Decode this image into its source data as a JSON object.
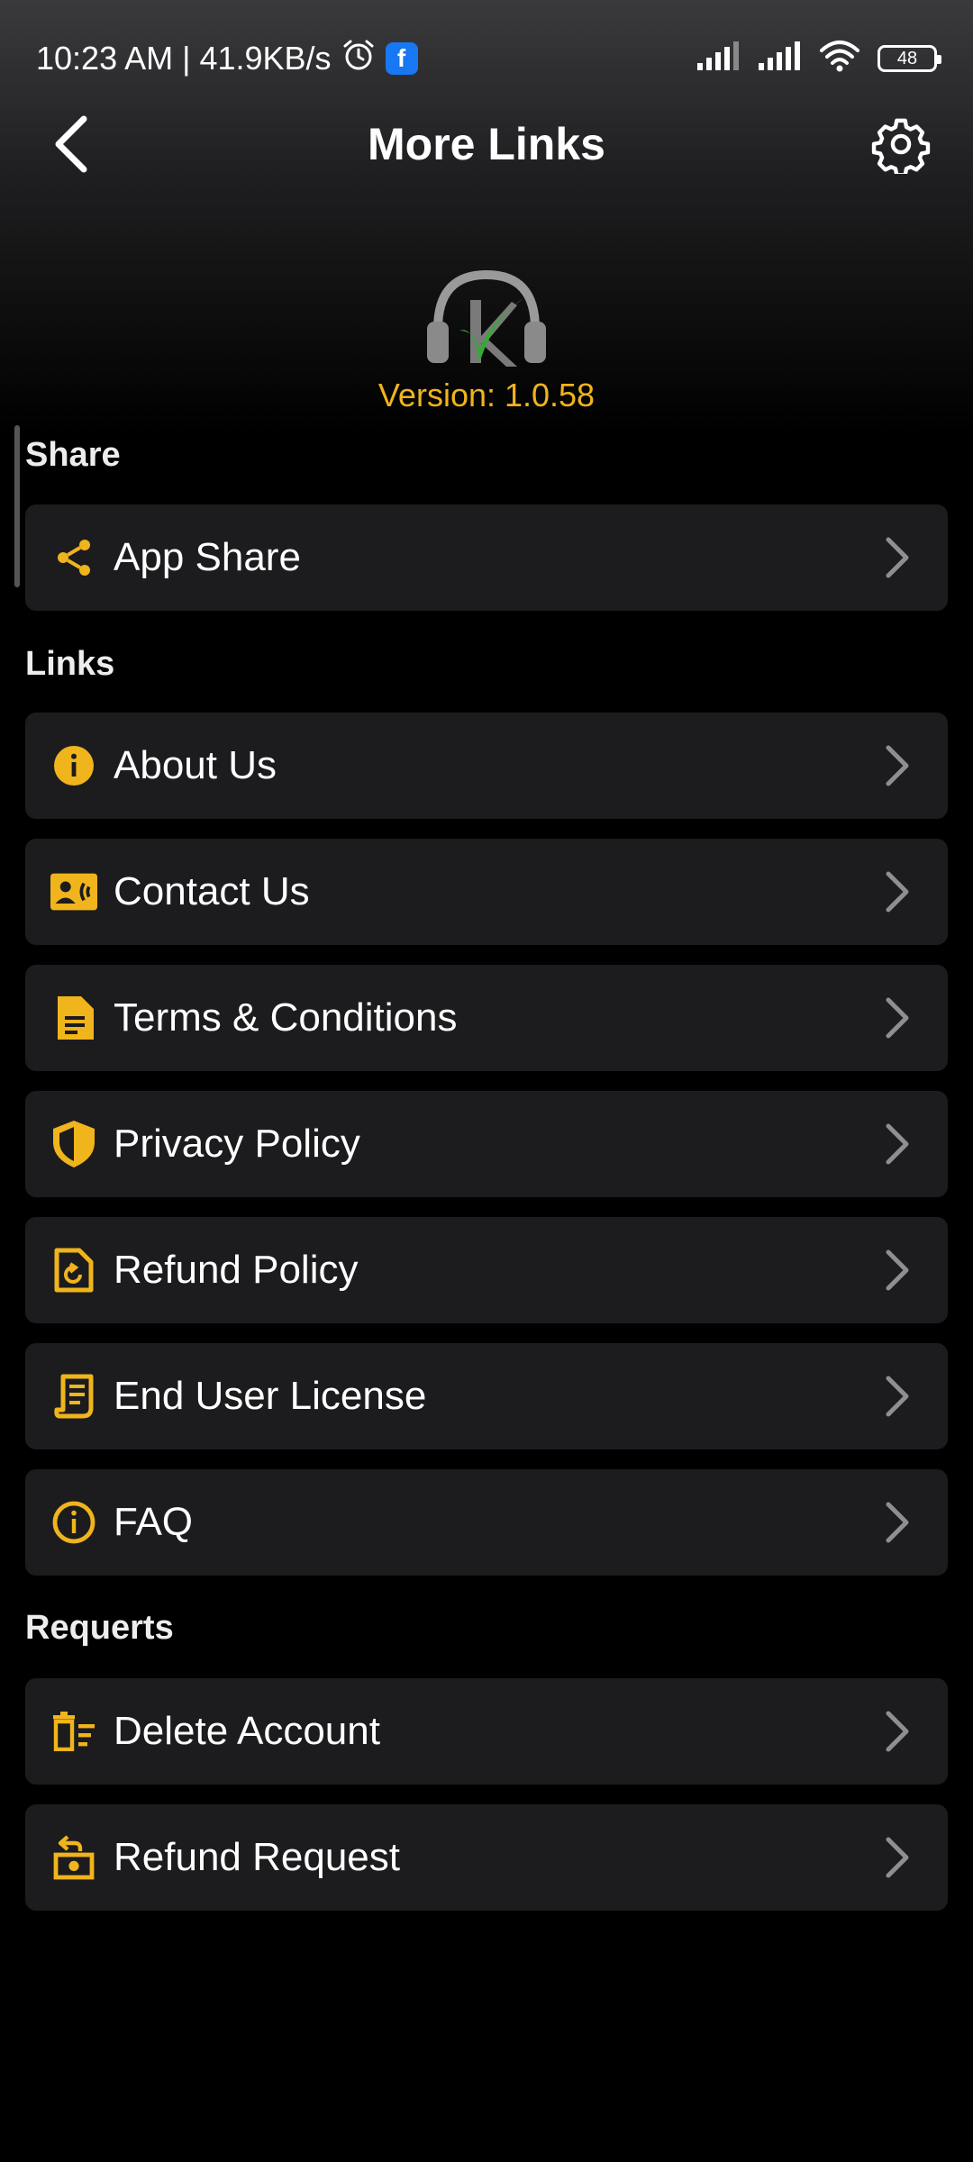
{
  "status_bar": {
    "time": "10:23 AM",
    "separator": "|",
    "speed": "41.9KB/s",
    "fb_letter": "f",
    "battery": "48"
  },
  "header": {
    "title": "More Links"
  },
  "app": {
    "version": "Version: 1.0.58"
  },
  "sections": {
    "share": {
      "label": "Share",
      "items": [
        {
          "label": "App Share",
          "icon": "share-icon"
        }
      ]
    },
    "links": {
      "label": "Links",
      "items": [
        {
          "label": "About Us",
          "icon": "info-filled-icon"
        },
        {
          "label": "Contact Us",
          "icon": "contact-card-icon"
        },
        {
          "label": "Terms & Conditions",
          "icon": "document-icon"
        },
        {
          "label": "Privacy Policy",
          "icon": "shield-icon"
        },
        {
          "label": "Refund Policy",
          "icon": "refund-document-icon"
        },
        {
          "label": "End User License",
          "icon": "license-icon"
        },
        {
          "label": "FAQ",
          "icon": "info-outline-icon"
        }
      ]
    },
    "requests": {
      "label": "Requerts",
      "items": [
        {
          "label": "Delete Account",
          "icon": "delete-account-icon"
        },
        {
          "label": "Refund Request",
          "icon": "refund-request-icon"
        }
      ]
    }
  },
  "colors": {
    "accent": "#f0b41c",
    "row_background": "#1c1c1e",
    "background": "#000000"
  }
}
